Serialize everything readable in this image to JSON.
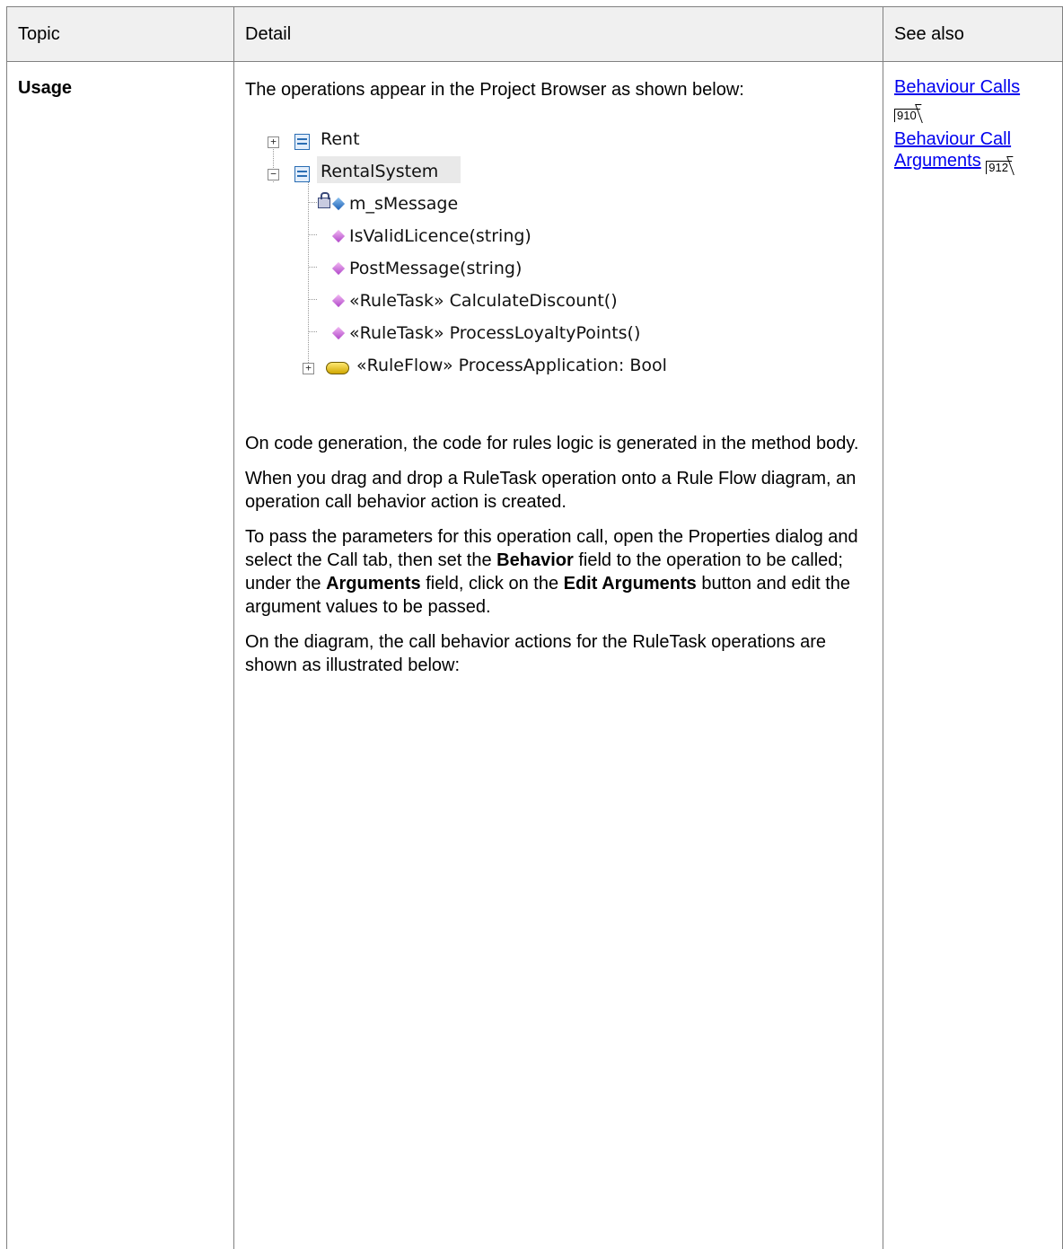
{
  "table": {
    "headers": {
      "topic": "Topic",
      "detail": "Detail",
      "see_also": "See also"
    },
    "row": {
      "topic": "Usage",
      "detail": {
        "intro": "The operations appear in the Project Browser as shown below:",
        "browser_tree": {
          "rent": "Rent",
          "rental_system": "RentalSystem",
          "m_smessage": "m_sMessage",
          "is_valid_licence": "IsValidLicence(string)",
          "post_message": "PostMessage(string)",
          "calculate_discount": "«RuleTask» CalculateDiscount()",
          "process_loyalty_points": "«RuleTask» ProcessLoyaltyPoints()",
          "process_application": "«RuleFlow» ProcessApplication: Bool"
        },
        "para1": "On code generation, the code for rules logic is generated in the method body.",
        "para2": "When you drag and drop a RuleTask operation onto a Rule Flow diagram, an operation call behavior action is created.",
        "para3": {
          "t1": "To pass the parameters for this operation call, open the Properties dialog and select the Call tab, then set the ",
          "b1": "Behavior",
          "t2": " field to the operation to be called; under the ",
          "b2": "Arguments",
          "t3": " field, click on the ",
          "b3": "Edit Arguments",
          "t4": " button and edit the argument values to be passed."
        },
        "para4": "On the diagram, the call behavior actions for the RuleTask operations are shown as illustrated below:"
      },
      "see_also": [
        {
          "label": "Behaviour Calls",
          "page": "910"
        },
        {
          "label": "Behaviour Call Arguments",
          "page": "912"
        }
      ]
    }
  }
}
